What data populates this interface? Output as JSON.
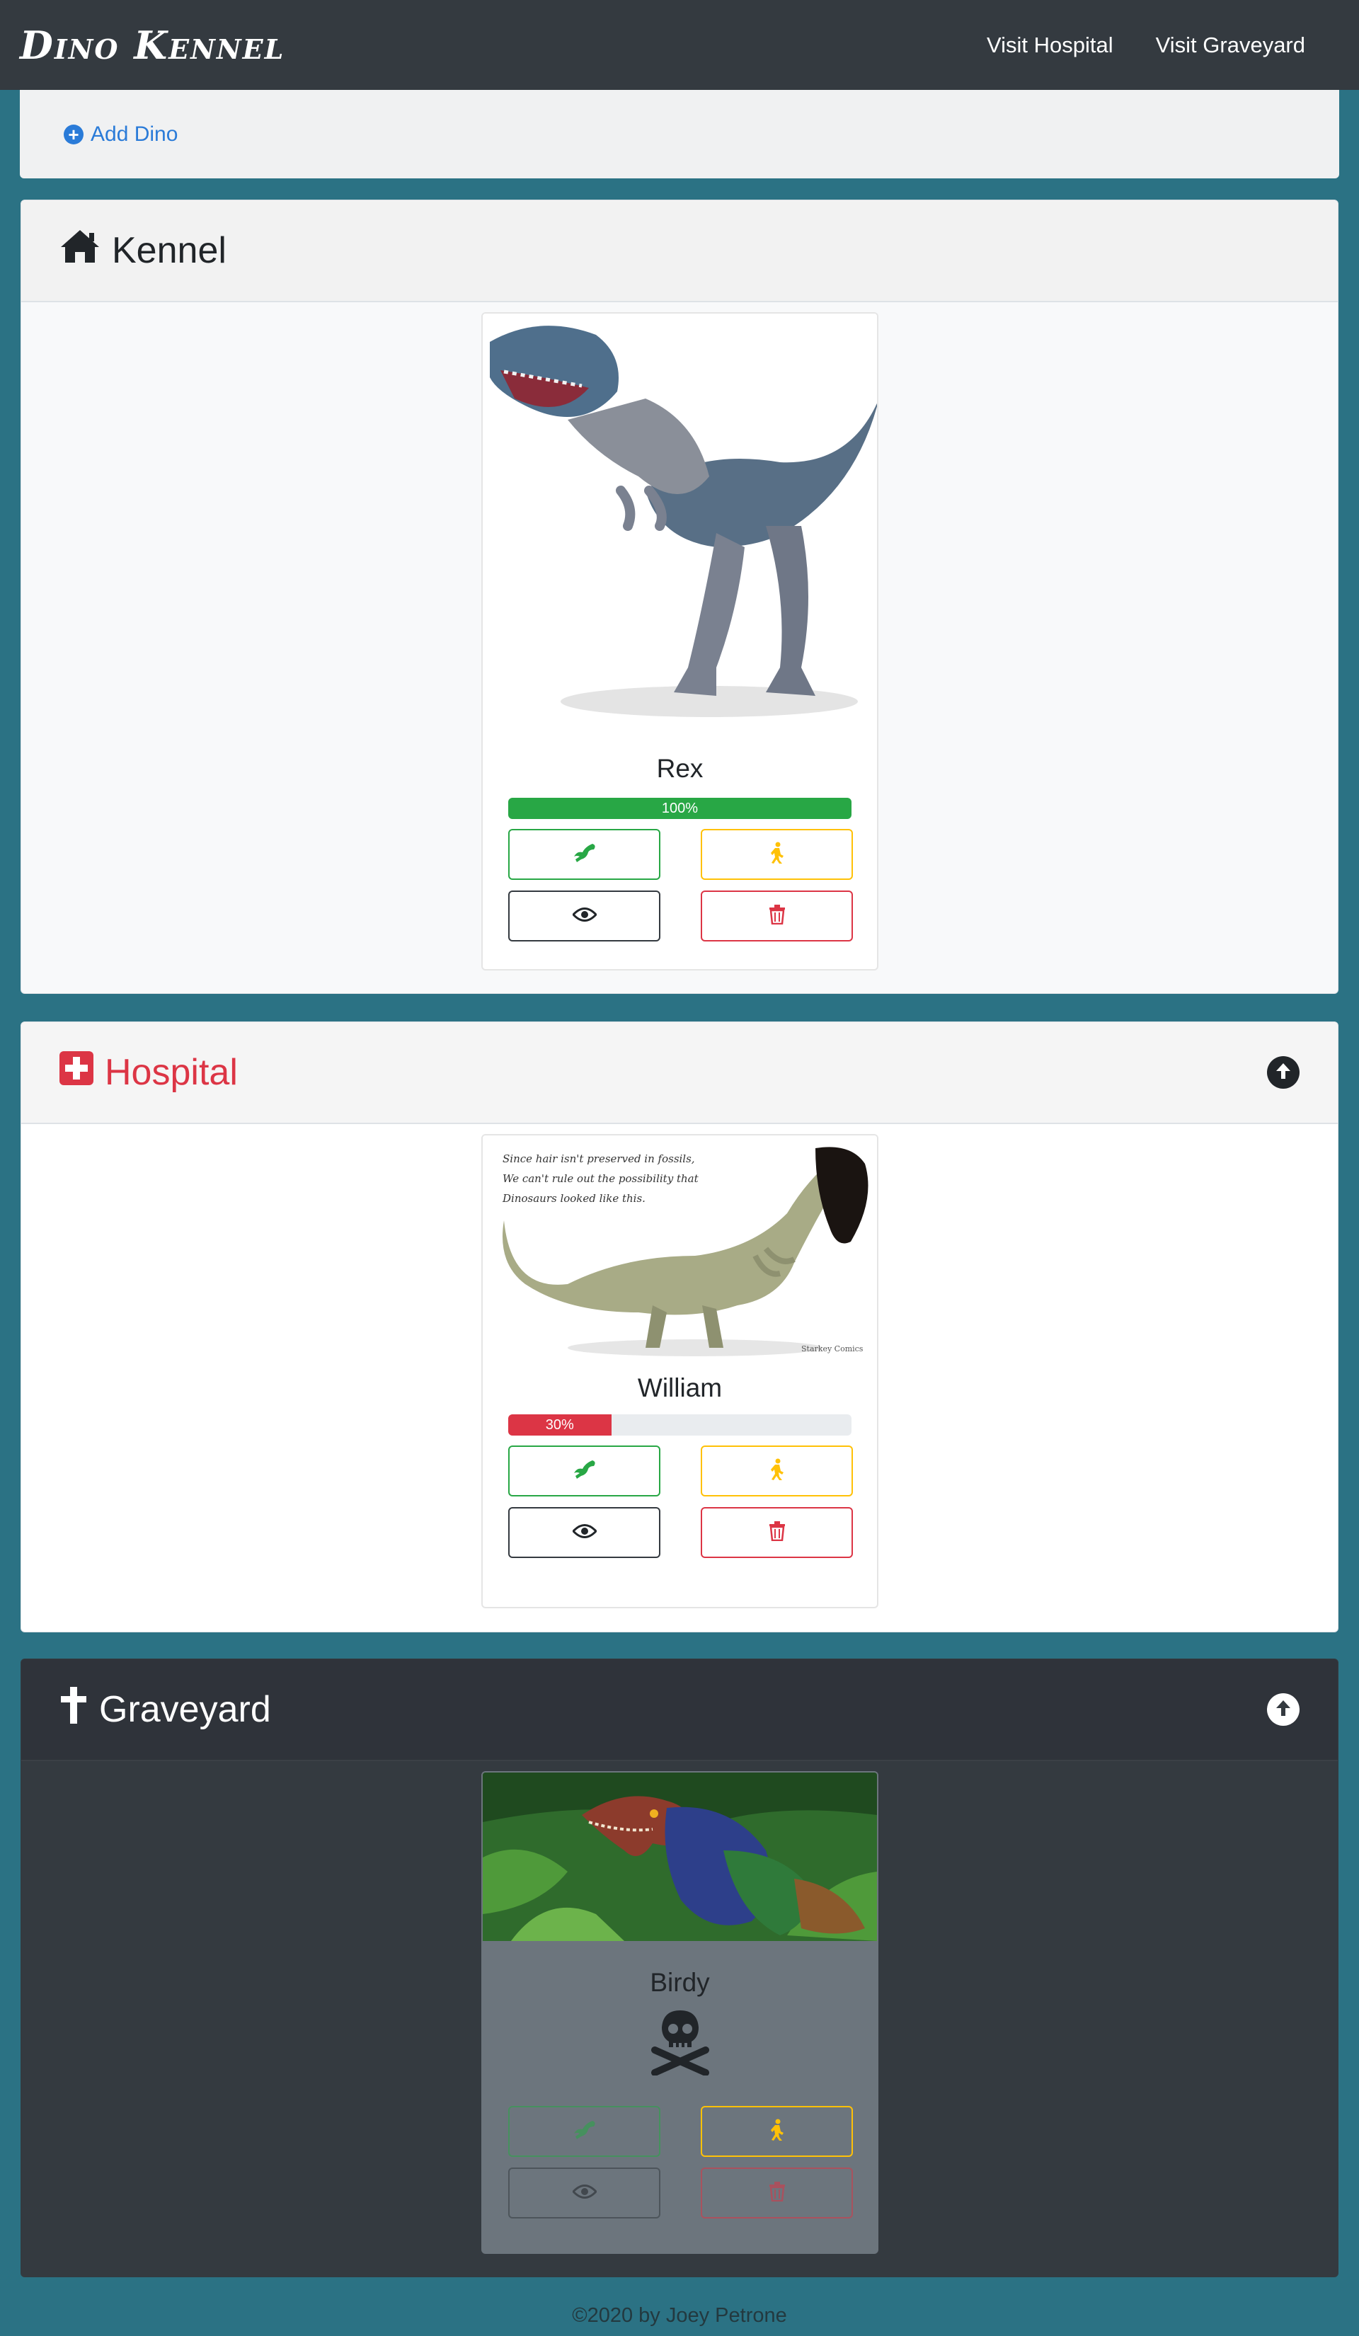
{
  "navbar": {
    "brand": "Dino Kennel",
    "links": [
      "Visit Hospital",
      "Visit Graveyard"
    ]
  },
  "toolbar": {
    "add_label": "Add Dino"
  },
  "kennel": {
    "title": "Kennel",
    "dinos": [
      {
        "name": "Rex",
        "health_label": "100%",
        "health": 1.0,
        "bar_color": "#28a745"
      }
    ]
  },
  "hospital": {
    "title": "Hospital",
    "dinos": [
      {
        "name": "William",
        "health_label": "30%",
        "health": 0.3,
        "bar_color": "#dc3545",
        "image_caption": [
          "Since hair isn't preserved in fossils,",
          "We can't rule out the possibility that",
          "Dinosaurs looked like this."
        ],
        "image_credit": "Starkey Comics"
      }
    ]
  },
  "graveyard": {
    "title": "Graveyard",
    "dinos": [
      {
        "name": "Birdy",
        "status_icon": "skull-crossbones-icon"
      }
    ]
  },
  "colors": {
    "bg": "#2b7284",
    "dark": "#343a40",
    "success": "#28a745",
    "warning": "#ffc107",
    "danger": "#dc3545",
    "primary": "#2a7bd8"
  },
  "icons": [
    "plus-circle-icon",
    "home-icon",
    "medical-cross-icon",
    "cross-icon",
    "arrow-up-circle-icon",
    "dino-icon",
    "walk-icon",
    "eye-icon",
    "trash-icon",
    "skull-crossbones-icon"
  ],
  "footer": {
    "text": "©2020 by Joey Petrone"
  }
}
